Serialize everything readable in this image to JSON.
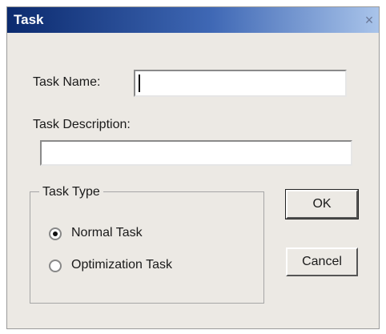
{
  "window": {
    "title": "Task",
    "close_glyph": "×"
  },
  "form": {
    "task_name_label": "Task Name:",
    "task_name_value": "",
    "task_description_label": "Task Description:",
    "task_description_value": "",
    "task_type_label": "Task Type",
    "options": [
      {
        "label": "Normal Task",
        "selected": true
      },
      {
        "label": "Optimization Task",
        "selected": false
      }
    ]
  },
  "buttons": {
    "ok": "OK",
    "cancel": "Cancel"
  }
}
